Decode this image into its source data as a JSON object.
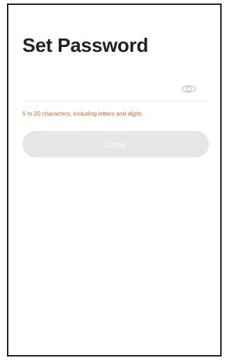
{
  "page": {
    "title": "Set Password"
  },
  "password_field": {
    "value": "",
    "placeholder": "",
    "toggle_icon": "eye-icon"
  },
  "hint": {
    "text": "6 to 20 characters, including letters and digits",
    "color": "#c9692a"
  },
  "done_button": {
    "label": "Done",
    "state": "disabled",
    "background": "#e6e6e6"
  }
}
